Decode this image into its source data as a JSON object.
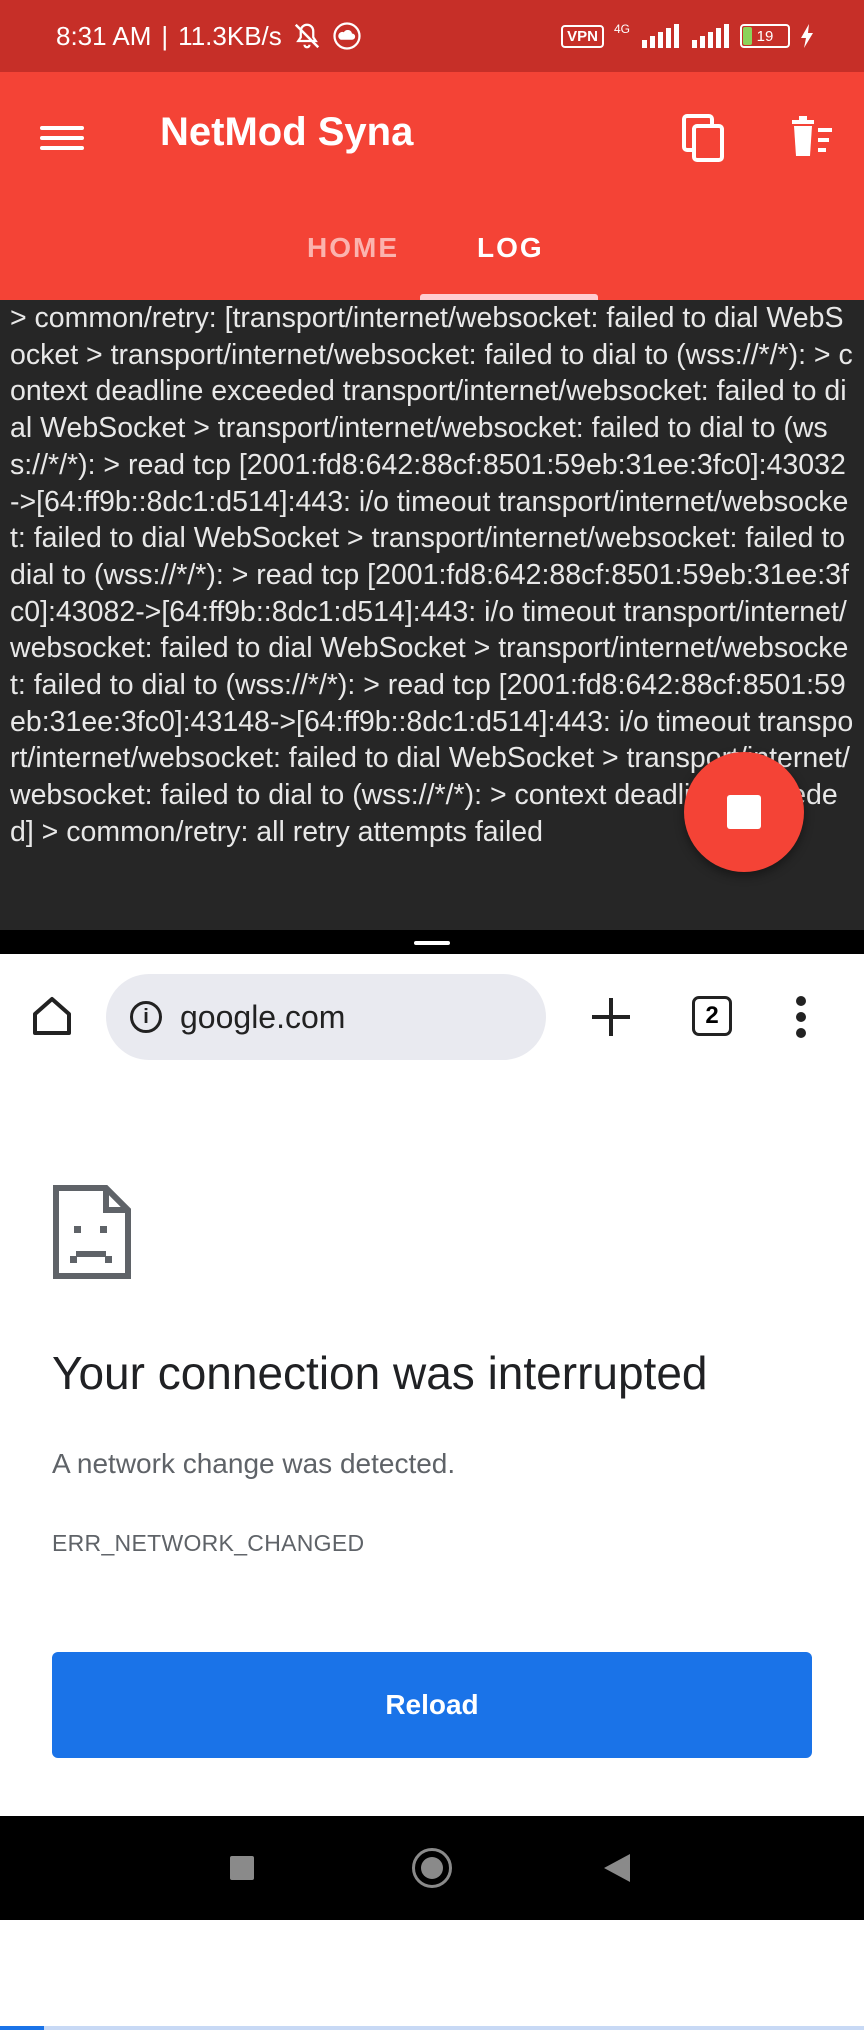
{
  "status_bar": {
    "time": "8:31 AM",
    "separator": "|",
    "speed": "11.3KB/s",
    "vpn": "VPN",
    "network": "4G",
    "battery": "19"
  },
  "app": {
    "title": "NetMod Syna",
    "tabs": [
      {
        "label": "HOME"
      },
      {
        "label": "LOG",
        "active": true
      }
    ],
    "accent": "#f44336"
  },
  "log": {
    "text": "> common/retry: [transport/internet/websocket: failed to dial WebSocket > transport/internet/websocket: failed to dial to (wss://*/*):  > context deadline exceeded transport/internet/websocket: failed to dial WebSocket > transport/internet/websocket: failed to dial to (wss://*/*):  > read tcp [2001:fd8:642:88cf:8501:59eb:31ee:3fc0]:43032->[64:ff9b::8dc1:d514]:443: i/o timeout transport/internet/websocket: failed to dial WebSocket > transport/internet/websocket: failed to dial to (wss://*/*):  > read tcp [2001:fd8:642:88cf:8501:59eb:31ee:3fc0]:43082->[64:ff9b::8dc1:d514]:443: i/o timeout transport/internet/websocket: failed to dial WebSocket > transport/internet/websocket: failed to dial to (wss://*/*):  > read tcp [2001:fd8:642:88cf:8501:59eb:31ee:3fc0]:43148->[64:ff9b::8dc1:d514]:443: i/o timeout transport/internet/websocket: failed to dial WebSocket > transport/internet/websocket: failed to dial to (wss://*/*):  > context deadline exceeded] > common/retry: all retry attempts failed"
  },
  "browser": {
    "url": "google.com",
    "tab_count": "2",
    "link_color": "#1a73e8"
  },
  "error_page": {
    "title": "Your connection was interrupted",
    "message": "A network change was detected.",
    "code": "ERR_NETWORK_CHANGED",
    "reload_label": "Reload"
  }
}
